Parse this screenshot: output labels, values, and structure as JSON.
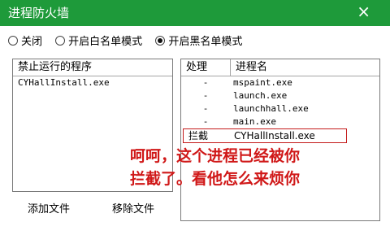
{
  "window": {
    "title": "进程防火墙",
    "close_icon": "×"
  },
  "mode_options": [
    {
      "label": "关闭",
      "checked": false
    },
    {
      "label": "开启白名单模式",
      "checked": false
    },
    {
      "label": "开启黑名单模式",
      "checked": true
    }
  ],
  "left_panel": {
    "header": "禁止运行的程序",
    "items": [
      "CYHallInstall.exe"
    ]
  },
  "right_panel": {
    "col_action": "处理",
    "col_name": "进程名",
    "rows": [
      {
        "action": "-",
        "name": "mspaint.exe"
      },
      {
        "action": "-",
        "name": "launch.exe"
      },
      {
        "action": "-",
        "name": "launchhall.exe"
      },
      {
        "action": "-",
        "name": "main.exe"
      },
      {
        "action": "拦截",
        "name": "CYHallInstall.exe"
      }
    ]
  },
  "buttons": {
    "add_file": "添加文件",
    "remove_file": "移除文件"
  },
  "annotation": {
    "line1": "呵呵，这个进程已经被你",
    "line2": "拦截了。看他怎么来烦你"
  },
  "colors": {
    "titlebar": "#1e9a3a",
    "highlight": "#c41b1b"
  }
}
